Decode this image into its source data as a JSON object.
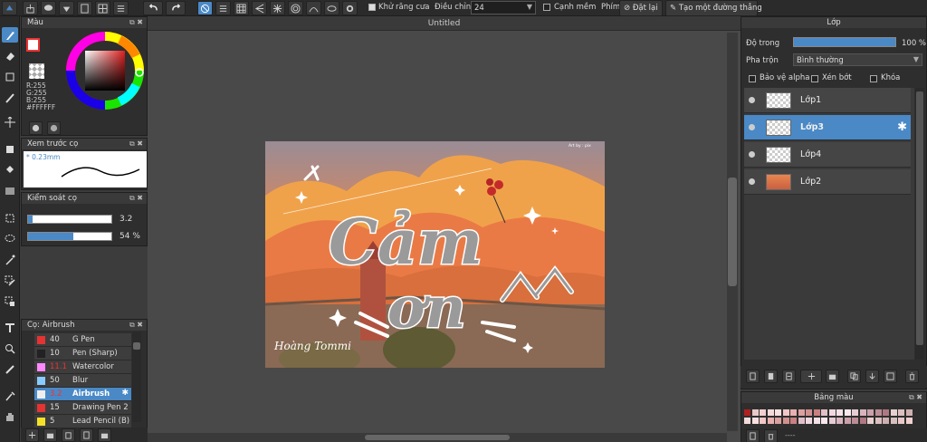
{
  "toolbar": {
    "antialias_label": "Khử răng cưa",
    "smooth_label": "Điều chỉnh",
    "smooth_value": "24",
    "soft_edge_label": "Cạnh mềm",
    "key_label": "Phím",
    "reset_label": "Đặt lại",
    "straight_line_label": "Tạo một đường thẳng"
  },
  "canvas": {
    "tab_title": "Untitled"
  },
  "color_panel": {
    "title": "Màu",
    "r": "R:255",
    "g": "G:255",
    "b": "B:255",
    "hex": "#FFFFFF"
  },
  "brush_preview": {
    "title": "Xem trước cọ",
    "size": "0.23mm"
  },
  "brush_control": {
    "title": "Kiểm soát cọ",
    "size_value": "3.2",
    "size_fill": 0.05,
    "opacity_value": "54 %",
    "opacity_fill": 0.54
  },
  "brush_list": {
    "title": "Cọ: Airbrush",
    "items": [
      {
        "size": "40",
        "name": "G Pen",
        "color": "#e33333"
      },
      {
        "size": "10",
        "name": "Pen (Sharp)",
        "color": "#222222"
      },
      {
        "size": "11.1",
        "name": "Watercolor",
        "color": "#ff88ff"
      },
      {
        "size": "50",
        "name": "Blur",
        "color": "#88ccff"
      },
      {
        "size": "3.2",
        "name": "Airbrush",
        "color": "#eeeeee"
      },
      {
        "size": "15",
        "name": "Drawing Pen 2",
        "color": "#e33333"
      },
      {
        "size": "5",
        "name": "Lead Pencil (B)",
        "color": "#f5e028"
      }
    ]
  },
  "layer_panel": {
    "title": "Lớp",
    "opacity_label": "Độ trong",
    "opacity_value": "100 %",
    "opacity_fill": 1.0,
    "blend_label": "Pha trộn",
    "blend_value": "Bình thường",
    "protect_alpha": "Bảo vệ alpha",
    "clipping": "Xén bớt",
    "lock": "Khóa",
    "layers": [
      {
        "name": "Lớp1",
        "selected": false
      },
      {
        "name": "Lớp3",
        "selected": true
      },
      {
        "name": "Lớp4",
        "selected": false
      },
      {
        "name": "Lớp2",
        "selected": false
      }
    ]
  },
  "palette": {
    "title": "Bảng màu",
    "footer": "----"
  },
  "artwork": {
    "line1": "Cảm",
    "line2": "ơn",
    "credit": "Art by : pix",
    "signature": "Hoàng Tommi"
  },
  "colors": {
    "accent": "#4a89c6",
    "sky": "#e8764a",
    "cloud": "#f2a64a"
  }
}
